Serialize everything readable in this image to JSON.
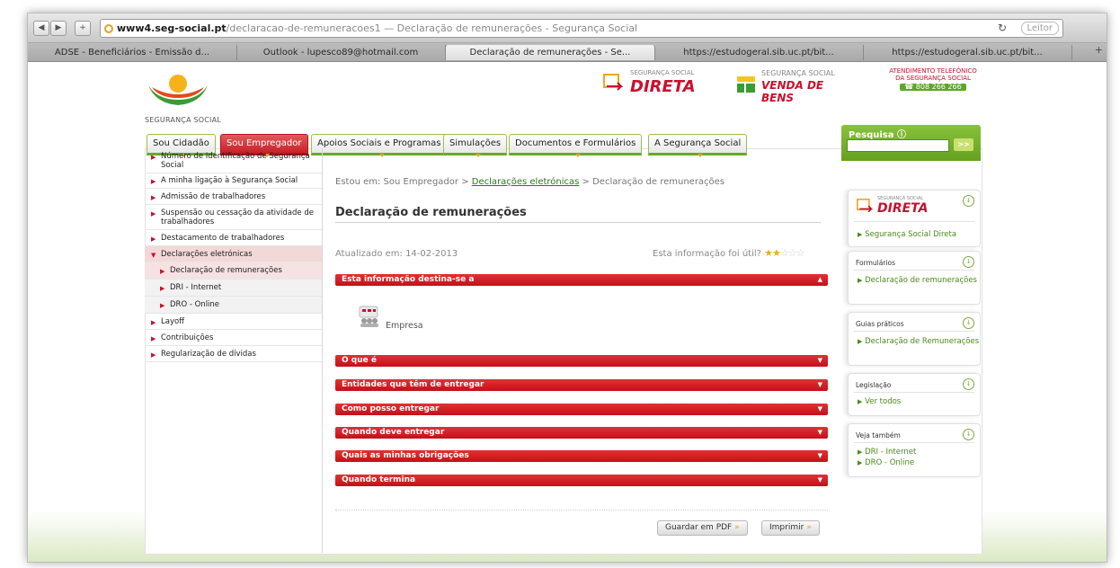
{
  "browser": {
    "url_host": "www4.seg-social.pt",
    "url_path": "/declaracao-de-remuneracoes1",
    "url_title": " — Declaração de remunerações - Segurança Social",
    "reader_label": "Leitor",
    "tabs": [
      {
        "label": "ADSE - Beneficiários - Emissão d..."
      },
      {
        "label": "Outlook - lupesco89@hotmail.com"
      },
      {
        "label": "Declaração de remunerações - Se..."
      },
      {
        "label": "https://estudogeral.sib.uc.pt/bit..."
      },
      {
        "label": "https://estudogeral.sib.uc.pt/bit..."
      }
    ]
  },
  "header": {
    "logo_text": "SEGURANÇA SOCIAL",
    "brand1_small": "SEGURANÇA SOCIAL",
    "brand1_big": "DIRETA",
    "brand2_small": "SEGURANÇA SOCIAL",
    "brand2_big": "VENDA DE BENS",
    "call_line1": "ATENDIMENTO TELEFÓNICO",
    "call_line2": "DA SEGURANÇA SOCIAL",
    "call_phone": "808 266 266"
  },
  "nav": {
    "tabs": [
      {
        "label": "Sou Cidadão"
      },
      {
        "label": "Sou Empregador"
      },
      {
        "label": "Apoios Sociais e Programas"
      },
      {
        "label": "Simulações"
      },
      {
        "label": "Documentos e Formulários"
      },
      {
        "label": "A Segurança Social"
      }
    ]
  },
  "search": {
    "label": "Pesquisa",
    "placeholder": "",
    "go_label": ">>"
  },
  "sidebar": {
    "items": [
      {
        "label": "Número de Identificação de Segurança Social"
      },
      {
        "label": "A minha ligação à Segurança Social"
      },
      {
        "label": "Admissão de trabalhadores"
      },
      {
        "label": "Suspensão ou cessação da atividade de trabalhadores"
      },
      {
        "label": "Destacamento de trabalhadores"
      },
      {
        "label": "Declarações eletrónicas"
      },
      {
        "label": "Declaração de remunerações"
      },
      {
        "label": "DRI - Internet"
      },
      {
        "label": "DRO - Online"
      },
      {
        "label": "Layoff"
      },
      {
        "label": "Contribuições"
      },
      {
        "label": "Regularização de dívidas"
      }
    ]
  },
  "main": {
    "breadcrumb_prefix": "Estou em:  Sou Empregador  > ",
    "breadcrumb_link": "Declarações eletrónicas",
    "breadcrumb_suffix": "  >  Declaração de remunerações",
    "title": "Declaração de remunerações",
    "updated": "Atualizado em: 14-02-2013",
    "useful_label": "Esta informação foi útil?",
    "rating_filled": 2,
    "rating_max": 5,
    "audience_label": "Empresa",
    "sections": [
      {
        "label": "Esta informação destina-se a",
        "expanded": true
      },
      {
        "label": "O que é"
      },
      {
        "label": "Entidades que têm de entregar"
      },
      {
        "label": "Como posso entregar"
      },
      {
        "label": "Quando deve entregar"
      },
      {
        "label": "Quais as minhas obrigações"
      },
      {
        "label": "Quando termina"
      }
    ],
    "save_pdf_label": "Guardar em PDF",
    "print_label": "Imprimir"
  },
  "right": {
    "direta_small": "SEGURANÇA SOCIAL",
    "direta_big": "DIRETA",
    "direta_link": "Segurança Social Direta",
    "boxes": [
      {
        "title": "Formulários",
        "links": [
          {
            "label": "Declaração de remunerações"
          }
        ]
      },
      {
        "title": "Guias práticos",
        "links": [
          {
            "label": "Declaração de Remunerações"
          }
        ]
      },
      {
        "title": "Legislação",
        "links": [
          {
            "label": "Ver todos"
          }
        ]
      },
      {
        "title": "Veja também",
        "links": [
          {
            "label": "DRI - Internet"
          },
          {
            "label": "DRO - Online"
          }
        ]
      }
    ]
  },
  "colors": {
    "brand_red": "#c8102e",
    "brand_green": "#6aa82c",
    "accent_orange": "#e8a218"
  }
}
